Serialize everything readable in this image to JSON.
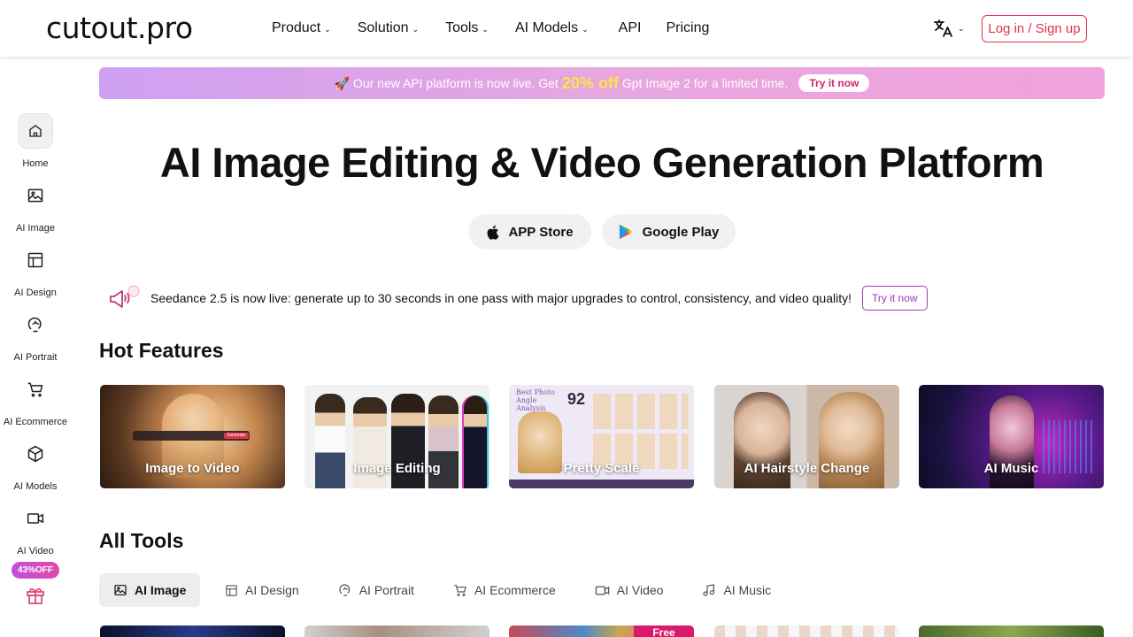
{
  "header": {
    "logo": "cutout.pro",
    "nav": [
      {
        "label": "Product",
        "dropdown": true
      },
      {
        "label": "Solution",
        "dropdown": true
      },
      {
        "label": "Tools",
        "dropdown": true
      },
      {
        "label": "AI Models",
        "dropdown": true
      },
      {
        "label": "API",
        "dropdown": false
      },
      {
        "label": "Pricing",
        "dropdown": false
      }
    ],
    "language_icon": "translate-icon",
    "login_label": "Log in / Sign up",
    "accent": "#e2334f"
  },
  "sidebar": {
    "items": [
      {
        "label": "Home",
        "icon": "home-icon",
        "active": true
      },
      {
        "label": "AI Image",
        "icon": "image-icon"
      },
      {
        "label": "AI Design",
        "icon": "layout-icon"
      },
      {
        "label": "AI Portrait",
        "icon": "portrait-icon"
      },
      {
        "label": "AI Ecommerce",
        "icon": "cart-icon"
      },
      {
        "label": "AI Models",
        "icon": "cube-icon"
      },
      {
        "label": "AI Video",
        "icon": "video-icon"
      }
    ],
    "promo_badge": "43%OFF",
    "promo_icon": "gift-icon"
  },
  "banner": {
    "text_before": "🚀 Our new API platform is now live. Get",
    "highlight": "20% off",
    "text_after": "Gpt Image 2 for a limited time.",
    "cta": "Try it now"
  },
  "hero": {
    "title": "AI Image Editing & Video Generation Platform",
    "app_store": "APP Store",
    "google_play": "Google Play"
  },
  "notice": {
    "text": "Seedance 2.5 is now live: generate up to 30 seconds in one pass with major upgrades to control, consistency, and video quality!",
    "cta": "Try it now"
  },
  "hot_features": {
    "title": "Hot Features",
    "cards": [
      {
        "label": "Image to Video",
        "overlay": "Generate"
      },
      {
        "label": "Image Editing"
      },
      {
        "label": "Pretty Scale",
        "overlay": "Best Photo Angle Analysis",
        "score": "92"
      },
      {
        "label": "AI Hairstyle Change"
      },
      {
        "label": "AI Music"
      }
    ]
  },
  "all_tools": {
    "title": "All Tools",
    "tabs": [
      {
        "label": "AI Image",
        "icon": "image-icon",
        "active": true
      },
      {
        "label": "AI Design",
        "icon": "layout-icon"
      },
      {
        "label": "AI Portrait",
        "icon": "portrait-icon"
      },
      {
        "label": "AI Ecommerce",
        "icon": "cart-icon"
      },
      {
        "label": "AI Video",
        "icon": "video-icon"
      },
      {
        "label": "AI Music",
        "icon": "music-icon"
      }
    ],
    "thumb_badge": "Free"
  }
}
